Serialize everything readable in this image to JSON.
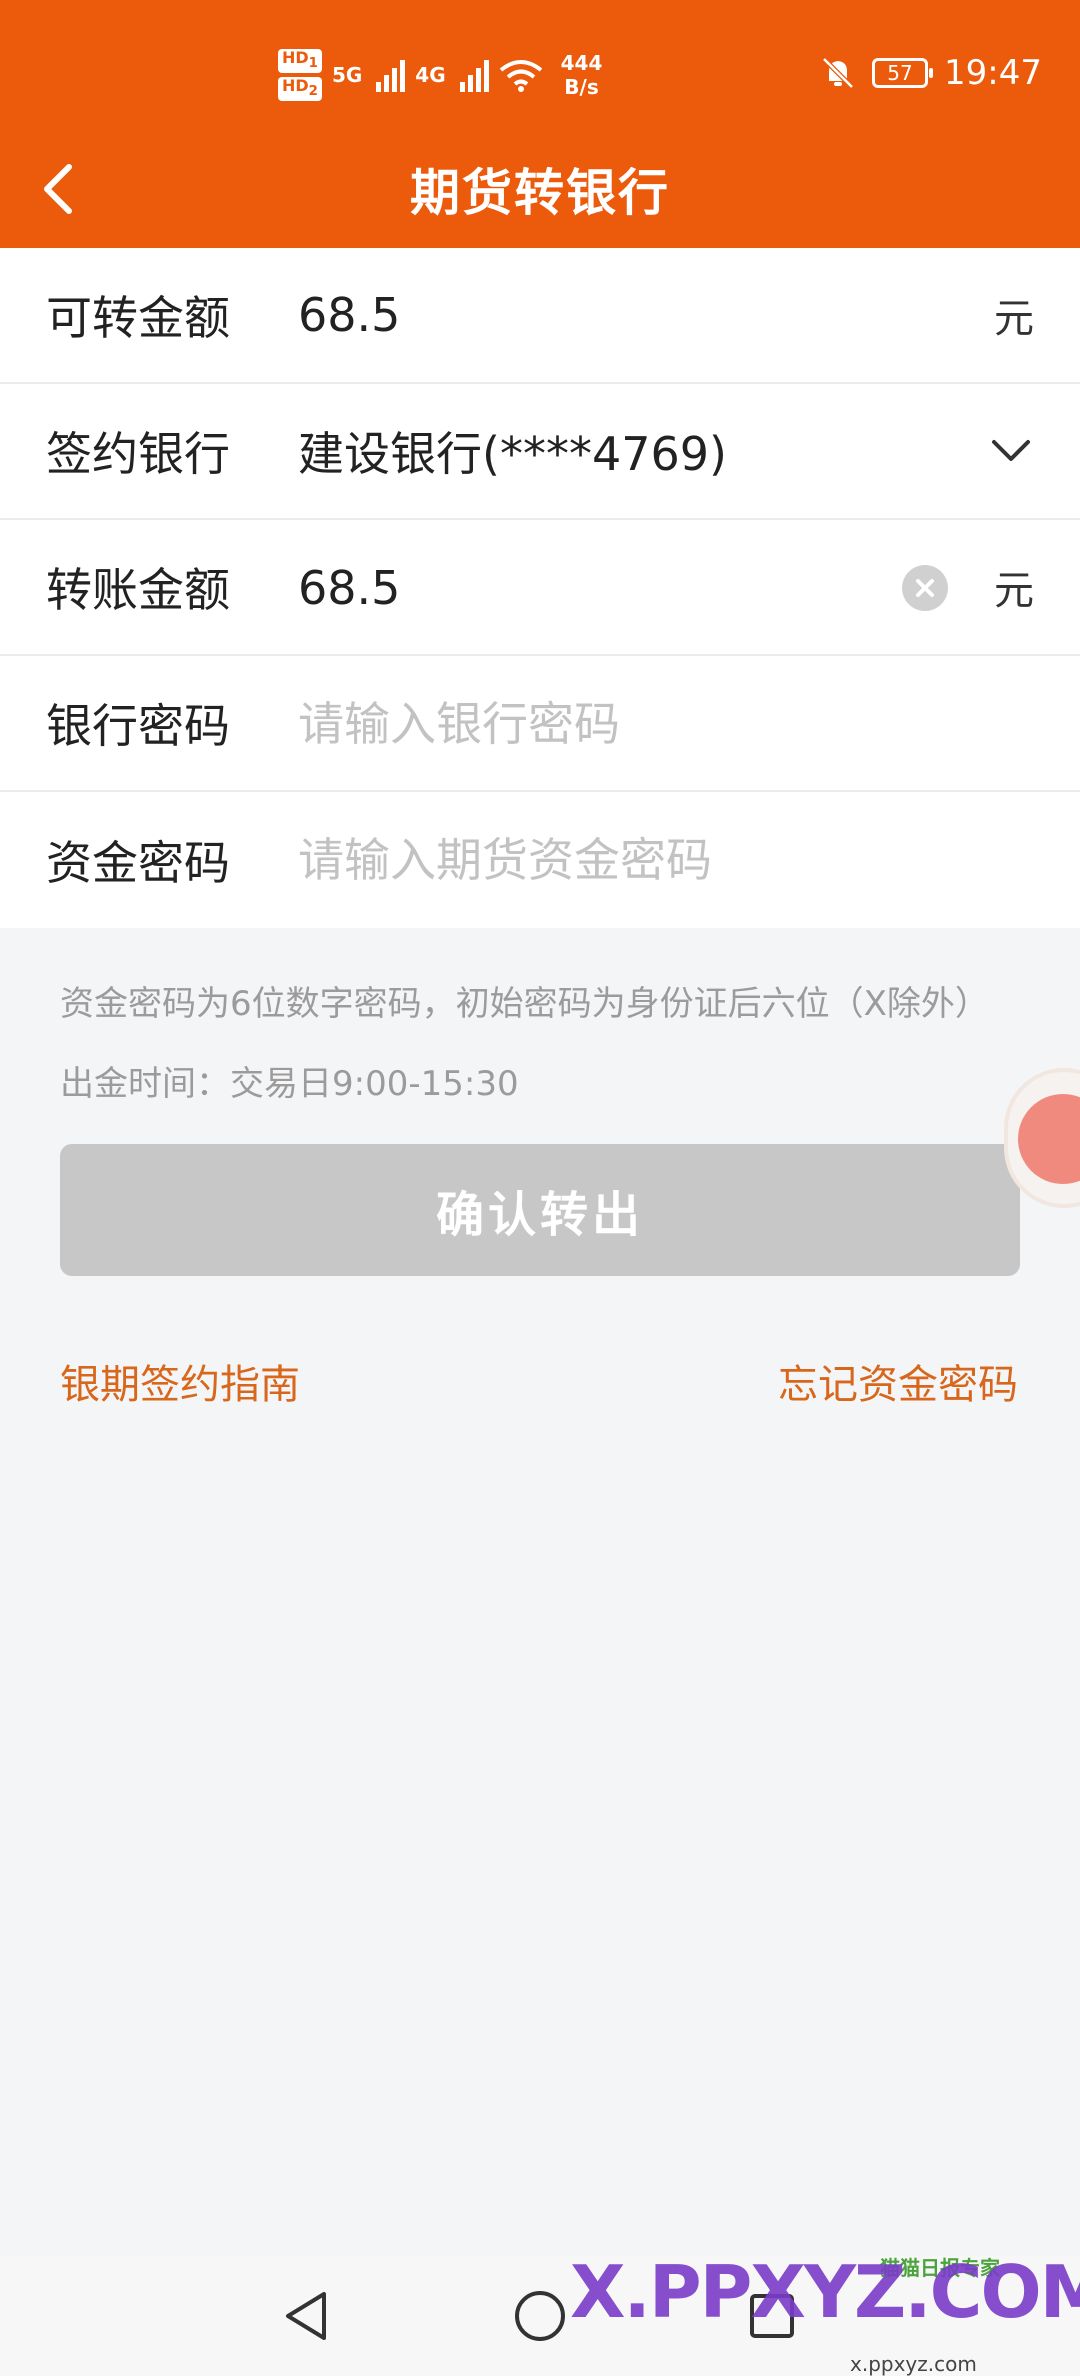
{
  "status_bar": {
    "hd1": "HD",
    "sim1": "1",
    "hd2": "HD",
    "sim2": "2",
    "net1": "5G",
    "net2": "4G",
    "speed_value": "444",
    "speed_unit": "B/s",
    "battery": "57",
    "time": "19:47"
  },
  "header": {
    "title": "期货转银行"
  },
  "form": {
    "available": {
      "label": "可转金额",
      "value": "68.5",
      "unit": "元"
    },
    "bank": {
      "label": "签约银行",
      "value": "建设银行(****4769)"
    },
    "amount": {
      "label": "转账金额",
      "value": "68.5",
      "unit": "元"
    },
    "bank_password": {
      "label": "银行密码",
      "placeholder": "请输入银行密码"
    },
    "fund_password": {
      "label": "资金密码",
      "placeholder": "请输入期货资金密码"
    }
  },
  "hints": {
    "password_rule": "资金密码为6位数字密码，初始密码为身份证后六位（X除外）",
    "withdraw_time": "出金时间：交易日9:00-15:30"
  },
  "actions": {
    "confirm": "确认转出",
    "guide_link": "银期签约指南",
    "forgot_link": "忘记资金密码"
  },
  "colors": {
    "brand": "#ec5a0c",
    "link": "#d8671c",
    "disabled_button": "#c7c7c7"
  },
  "watermark": {
    "logo_text": "X.PPXYZ.COM",
    "badge": "猫猫日报专家",
    "url": "x.ppxyz.com"
  }
}
